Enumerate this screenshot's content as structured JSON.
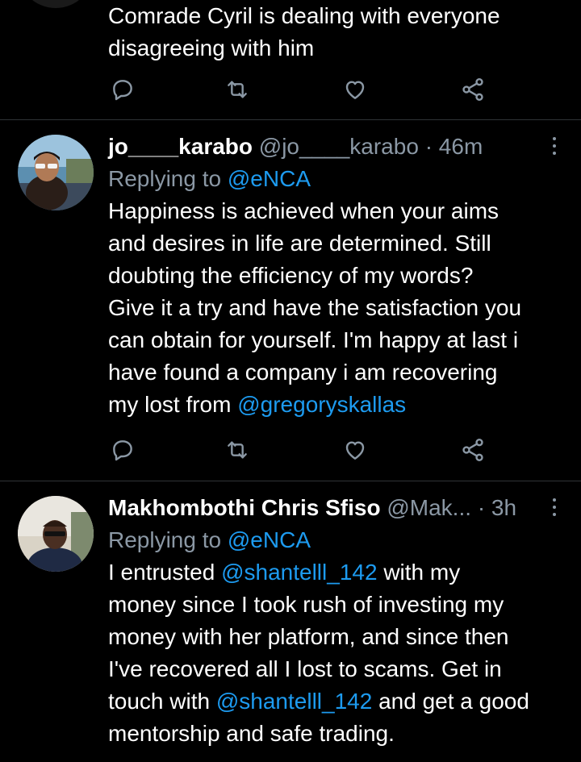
{
  "tweets": [
    {
      "text_lines": [
        "Comrade Cyril is dealing with everyone",
        "disagreeing with him"
      ]
    },
    {
      "name": "jo____karabo",
      "handle": "@jo____karabo",
      "separator": "·",
      "time": "46m",
      "replying_prefix": "Replying to",
      "replying_to": "@eNCA",
      "text_lines": [
        "Happiness is achieved when your aims",
        "and desires in life are determined.  Still",
        "doubting the efficiency of my words?",
        "Give it a try and have the satisfaction you",
        "can obtain for yourself.  I'm happy at last i",
        "have found a company i am recovering"
      ],
      "last_line_prefix": "my lost from ",
      "last_line_mention": "@gregoryskallas"
    },
    {
      "name": "Makhombothi Chris Sfiso",
      "handle": "@Mak...",
      "separator": "·",
      "time": "3h",
      "replying_prefix": "Replying to",
      "replying_to": "@eNCA",
      "line1_prefix": "I entrusted ",
      "line1_mention": "@shantelll_142",
      "line1_suffix": " with my",
      "text_lines": [
        "money since I took rush of investing my",
        "money with her platform, and since then",
        "I've recovered all I lost to scams. Get in"
      ],
      "line5_prefix": "touch with ",
      "line5_mention": "@shantelll_142",
      "line5_suffix": " and get a good",
      "line6": "mentorship and safe trading."
    }
  ],
  "action_icons": [
    "reply-icon",
    "retweet-icon",
    "like-icon",
    "share-icon"
  ],
  "colors": {
    "background": "#000000",
    "text": "#ffffff",
    "secondary": "#8b98a5",
    "link": "#1d9bf0",
    "divider": "#2f3336"
  }
}
